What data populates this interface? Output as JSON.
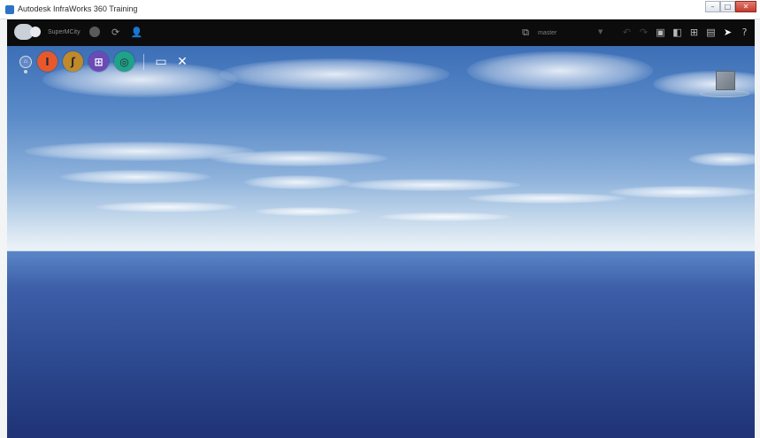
{
  "window": {
    "title": "Autodesk InfraWorks 360   Training",
    "minimize_symbol": "–",
    "maximize_symbol": "□",
    "close_symbol": "✕"
  },
  "toolbar": {
    "scenario_label": "SuperMCity",
    "proposal_label": "master",
    "dropdown_caret": "▼",
    "icons": {
      "avatar": "avatar-icon",
      "record": "record-icon",
      "sync": "sync-icon",
      "user": "user-icon",
      "proposal": "proposal-icon",
      "undo": "undo-icon",
      "redo": "redo-icon",
      "panel1": "model-properties-icon",
      "panel2": "layers-panel-icon",
      "panel3": "grid-view-icon",
      "panel4": "presentation-icon",
      "pointer": "select-pointer-icon",
      "help": "help-icon"
    },
    "glyphs": {
      "record": "●",
      "sync": "⟳",
      "user": "👤",
      "proposal": "⧉",
      "undo": "↶",
      "redo": "↷",
      "panel1": "▣",
      "panel2": "◧",
      "panel3": "⊞",
      "panel4": "▤",
      "pointer": "➤",
      "help": "?"
    }
  },
  "tools": {
    "home_glyph": "⌂",
    "items": [
      {
        "name": "build-manage-analyze-icon",
        "glyph": "I",
        "color": "#e8582a"
      },
      {
        "name": "roads-icon",
        "glyph": "ʃ",
        "color": "#c08a2a"
      },
      {
        "name": "bridges-icon",
        "glyph": "⊞",
        "color": "#6a4bb6"
      },
      {
        "name": "drainage-icon",
        "glyph": "◎",
        "color": "#1fa28a"
      }
    ],
    "presentation_glyph": "▭",
    "settings_glyph": "✕"
  },
  "colors": {
    "toolbar_bg": "#0c0c0c",
    "sky_top": "#3d6fb7",
    "sea_deep": "#1f3376"
  }
}
